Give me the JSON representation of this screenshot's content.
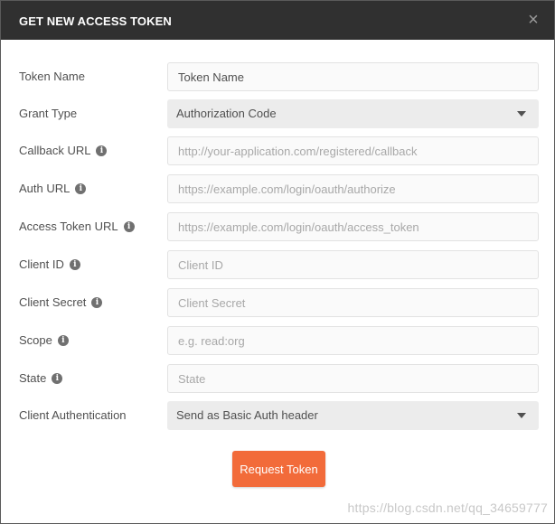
{
  "dialog": {
    "title": "GET NEW ACCESS TOKEN",
    "close_glyph": "×"
  },
  "fields": [
    {
      "label": "Token Name",
      "value": "Token Name",
      "placeholder": "",
      "info": false,
      "kind": "input"
    },
    {
      "label": "Grant Type",
      "value": "Authorization Code",
      "info": false,
      "kind": "select"
    },
    {
      "label": "Callback URL",
      "value": "",
      "placeholder": "http://your-application.com/registered/callback",
      "info": true,
      "kind": "input"
    },
    {
      "label": "Auth URL",
      "value": "",
      "placeholder": "https://example.com/login/oauth/authorize",
      "info": true,
      "kind": "input"
    },
    {
      "label": "Access Token URL",
      "value": "",
      "placeholder": "https://example.com/login/oauth/access_token",
      "info": true,
      "kind": "input"
    },
    {
      "label": "Client ID",
      "value": "",
      "placeholder": "Client ID",
      "info": true,
      "kind": "input"
    },
    {
      "label": "Client Secret",
      "value": "",
      "placeholder": "Client Secret",
      "info": true,
      "kind": "input"
    },
    {
      "label": "Scope",
      "value": "",
      "placeholder": "e.g. read:org",
      "info": true,
      "kind": "input"
    },
    {
      "label": "State",
      "value": "",
      "placeholder": "State",
      "info": true,
      "kind": "input"
    },
    {
      "label": "Client Authentication",
      "value": "Send as Basic Auth header",
      "info": false,
      "kind": "select"
    }
  ],
  "info_icon_glyph": "i",
  "request_button_label": "Request Token",
  "watermark": "https://blog.csdn.net/qq_34659777",
  "colors": {
    "header_bg": "#303030",
    "accent": "#f26b3a",
    "select_bg": "#ececec"
  }
}
